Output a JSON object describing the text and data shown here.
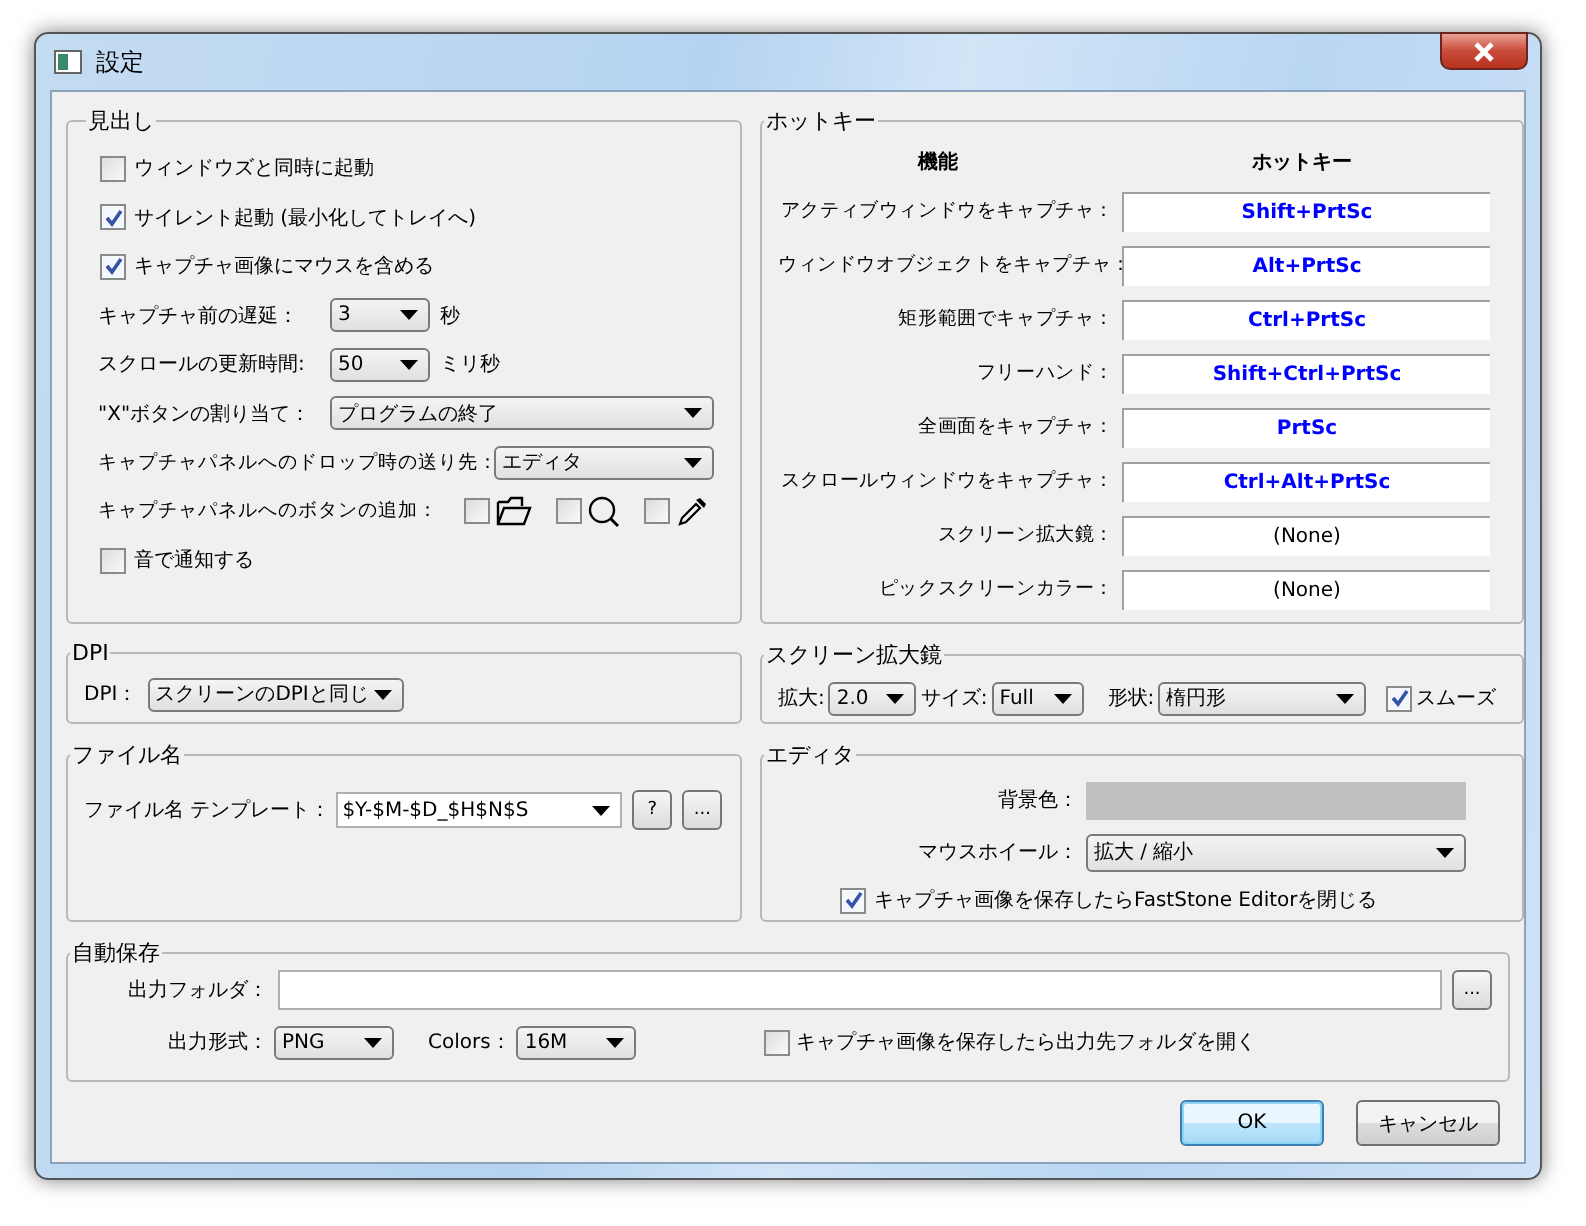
{
  "window": {
    "title": "設定"
  },
  "general": {
    "legend": "見出し",
    "rows": [
      {
        "kind": "checkbox",
        "label": "ウィンドウズと同時に起動",
        "checked": false
      },
      {
        "kind": "checkbox",
        "label": "サイレント起動 (最小化してトレイへ)",
        "checked": true
      },
      {
        "kind": "checkbox",
        "label": "キャプチャ画像にマウスを含める",
        "checked": true
      },
      {
        "kind": "select",
        "label": "キャプチャ前の遅延：",
        "value": "3",
        "unit": "秒"
      },
      {
        "kind": "select",
        "label": "スクロールの更新時間:",
        "value": "50",
        "unit": "ミリ秒"
      },
      {
        "kind": "select",
        "label": "\"X\"ボタンの割り当て：",
        "value": "プログラムの終了"
      },
      {
        "kind": "select",
        "label": "キャプチャパネルへのドロップ時の送り先：",
        "value": "エディタ"
      },
      {
        "kind": "toggles",
        "label": "キャプチャパネルへのボタンの追加：",
        "items": [
          {
            "checked": false
          },
          {
            "checked": false
          },
          {
            "checked": false
          }
        ]
      },
      {
        "kind": "checkbox",
        "label": "音で通知する",
        "checked": false
      }
    ]
  },
  "hotkeys": {
    "legend": "ホットキー",
    "column_1": "機能",
    "column_2": "ホットキー",
    "rows": [
      {
        "label": "アクティブウィンドウをキャプチャ：",
        "key": "Shift+PrtSc",
        "assigned": true
      },
      {
        "label": "ウィンドウオブジェクトをキャプチャ：",
        "key": "Alt+PrtSc",
        "assigned": true
      },
      {
        "label": "矩形範囲でキャプチャ：",
        "key": "Ctrl+PrtSc",
        "assigned": true
      },
      {
        "label": "フリーハンド：",
        "key": "Shift+Ctrl+PrtSc",
        "assigned": true
      },
      {
        "label": "全画面をキャプチャ：",
        "key": "PrtSc",
        "assigned": true
      },
      {
        "label": "スクロールウィンドウをキャプチャ：",
        "key": "Ctrl+Alt+PrtSc",
        "assigned": true
      },
      {
        "label": "スクリーン拡大鏡：",
        "key": "(None)",
        "assigned": false
      },
      {
        "label": "ピックスクリーンカラー：",
        "key": "(None)",
        "assigned": false
      }
    ]
  },
  "dpi": {
    "legend": "DPI",
    "label": "DPI：",
    "value": "スクリーンのDPIと同じ"
  },
  "magnifier": {
    "legend": "スクリーン拡大鏡",
    "fields": [
      {
        "label": "拡大:",
        "value": "2.0"
      },
      {
        "label": "サイズ:",
        "value": "Full"
      },
      {
        "label": "形状:",
        "value": "楕円形"
      }
    ],
    "smooth": {
      "label": "スムーズ",
      "checked": true
    }
  },
  "filename": {
    "legend": "ファイル名",
    "label": "ファイル名 テンプレート：",
    "value": "$Y-$M-$D_$H$N$S",
    "buttons": [
      "?",
      "..."
    ]
  },
  "editor": {
    "legend": "エディタ",
    "bg_label": "背景色：",
    "wheel_label": "マウスホイール：",
    "wheel_value": "拡大 / 縮小",
    "close": {
      "label": "キャプチャ画像を保存したらFastStone Editorを閉じる",
      "checked": true
    }
  },
  "autosave": {
    "legend": "自動保存",
    "folder_label": "出力フォルダ：",
    "browse": "...",
    "format_label": "出力形式：",
    "format_value": "PNG",
    "colors_label": "Colors：",
    "colors_value": "16M",
    "open": {
      "label": "キャプチャ画像を保存したら出力先フォルダを開く",
      "checked": false
    }
  },
  "buttons": [
    {
      "label": "OK",
      "default": true
    },
    {
      "label": "キャンセル",
      "default": false
    }
  ]
}
